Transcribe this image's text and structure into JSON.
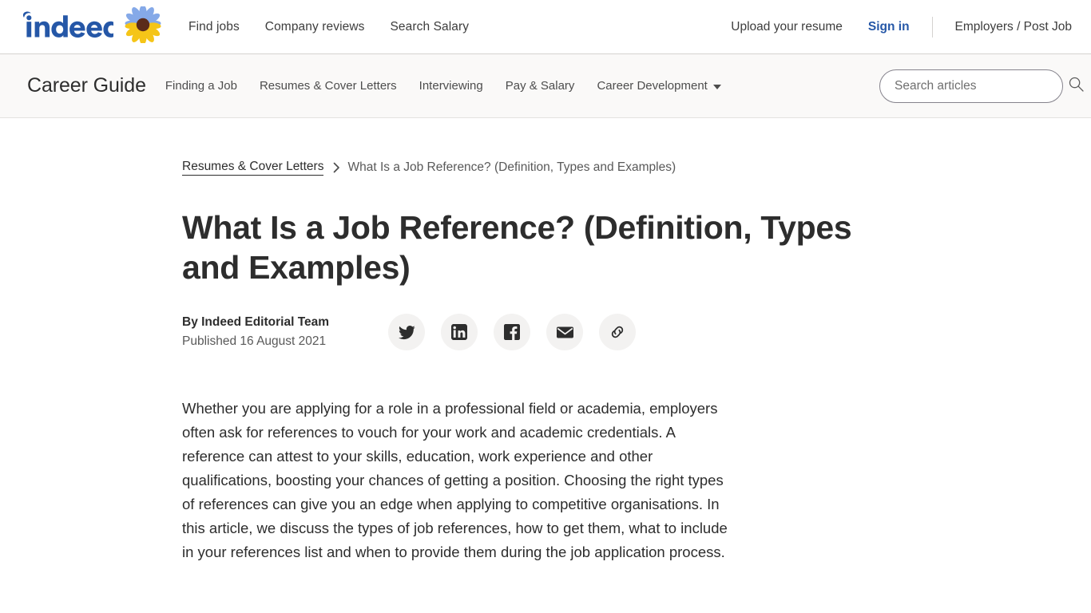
{
  "global_nav": {
    "brand": {
      "name": "indeed",
      "logo_color": "#2557a7",
      "sunflower_petal_top_color": "#85a9e8",
      "sunflower_petal_bottom_color": "#f5c518",
      "sunflower_center_color": "#5b2b1a"
    },
    "links": [
      {
        "label": "Find jobs",
        "name": "find-jobs"
      },
      {
        "label": "Company reviews",
        "name": "company-reviews"
      },
      {
        "label": "Search Salary",
        "name": "search-salary"
      }
    ],
    "upload_resume": "Upload your resume",
    "sign_in": "Sign in",
    "sign_in_color": "#2557a7",
    "employers": "Employers / Post Job"
  },
  "career_guide_nav": {
    "title": "Career Guide",
    "links": [
      {
        "label": "Finding a Job",
        "has_caret": false
      },
      {
        "label": "Resumes & Cover Letters",
        "has_caret": false
      },
      {
        "label": "Interviewing",
        "has_caret": false
      },
      {
        "label": "Pay & Salary",
        "has_caret": false
      },
      {
        "label": "Career Development",
        "has_caret": true
      }
    ],
    "search": {
      "placeholder": "Search articles",
      "value": "",
      "icon": "search-icon"
    },
    "background_color": "#faf9f8"
  },
  "breadcrumb": {
    "parent": "Resumes & Cover Letters",
    "separator": "›",
    "current": "What Is a Job Reference? (Definition, Types and Examples)"
  },
  "article": {
    "title": "What Is a Job Reference? (Definition, Types and Examples)",
    "author": "By Indeed Editorial Team",
    "published": "Published 16 August 2021",
    "share_buttons": [
      {
        "name": "share-twitter-button",
        "label": "Twitter"
      },
      {
        "name": "share-linkedin-button",
        "label": "LinkedIn"
      },
      {
        "name": "share-facebook-button",
        "label": "Facebook"
      },
      {
        "name": "share-email-button",
        "label": "Email"
      },
      {
        "name": "share-link-button",
        "label": "Copy link"
      }
    ],
    "paragraphs": [
      "Whether you are applying for a role in a professional field or academia, employers often ask for references to vouch for your work and academic credentials. A reference can attest to your skills, education, work experience and other qualifications, boosting your chances of getting a position. Choosing the right types of references can give you an edge when applying to competitive organisations. In this article, we discuss the types of job references, how to get them, what to include in your references list and when to provide them during the job application process."
    ]
  }
}
